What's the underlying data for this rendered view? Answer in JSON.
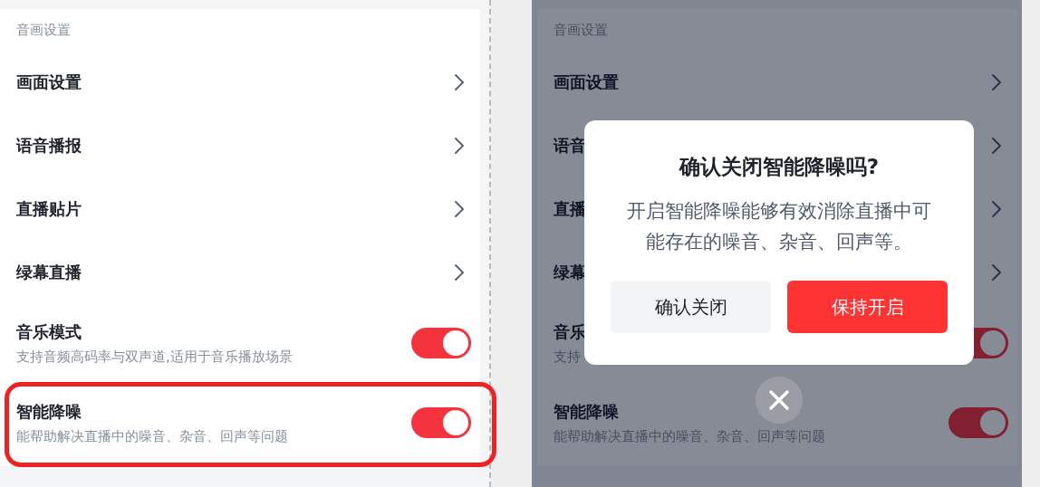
{
  "screens": [
    {
      "dimmed": false,
      "section_title": "音画设置",
      "rows": [
        {
          "kind": "link",
          "title": "画面设置"
        },
        {
          "kind": "link",
          "title": "语音播报"
        },
        {
          "kind": "link",
          "title": "直播贴片"
        },
        {
          "kind": "link",
          "title": "绿幕直播"
        },
        {
          "kind": "toggle",
          "title": "音乐模式",
          "description": "支持音频高码率与双声道,适用于音乐播放场景",
          "on": true,
          "highlighted": false
        },
        {
          "kind": "toggle",
          "title": "智能降噪",
          "description": "能帮助解决直播中的噪音、杂音、回声等问题",
          "on": true,
          "highlighted": true
        }
      ]
    },
    {
      "dimmed": true,
      "section_title": "音画设置",
      "rows": [
        {
          "kind": "link",
          "title": "画面设置"
        },
        {
          "kind": "link",
          "title": "语音"
        },
        {
          "kind": "link",
          "title": "直播"
        },
        {
          "kind": "link",
          "title": "绿幕"
        },
        {
          "kind": "toggle",
          "title": "音乐",
          "description": "支持",
          "on": true,
          "highlighted": false
        },
        {
          "kind": "toggle",
          "title": "智能降噪",
          "description": "能帮助解决直播中的噪音、杂音、回声等问题",
          "on": true,
          "highlighted": false
        }
      ],
      "dialog": {
        "title": "确认关闭智能降噪吗?",
        "message": "开启智能降噪能够有效消除直播中可能存在的噪音、杂音、回声等。",
        "buttons": [
          {
            "label": "确认关闭",
            "kind": "secondary"
          },
          {
            "label": "保持开启",
            "kind": "primary"
          }
        ],
        "close_button": true
      }
    }
  ]
}
